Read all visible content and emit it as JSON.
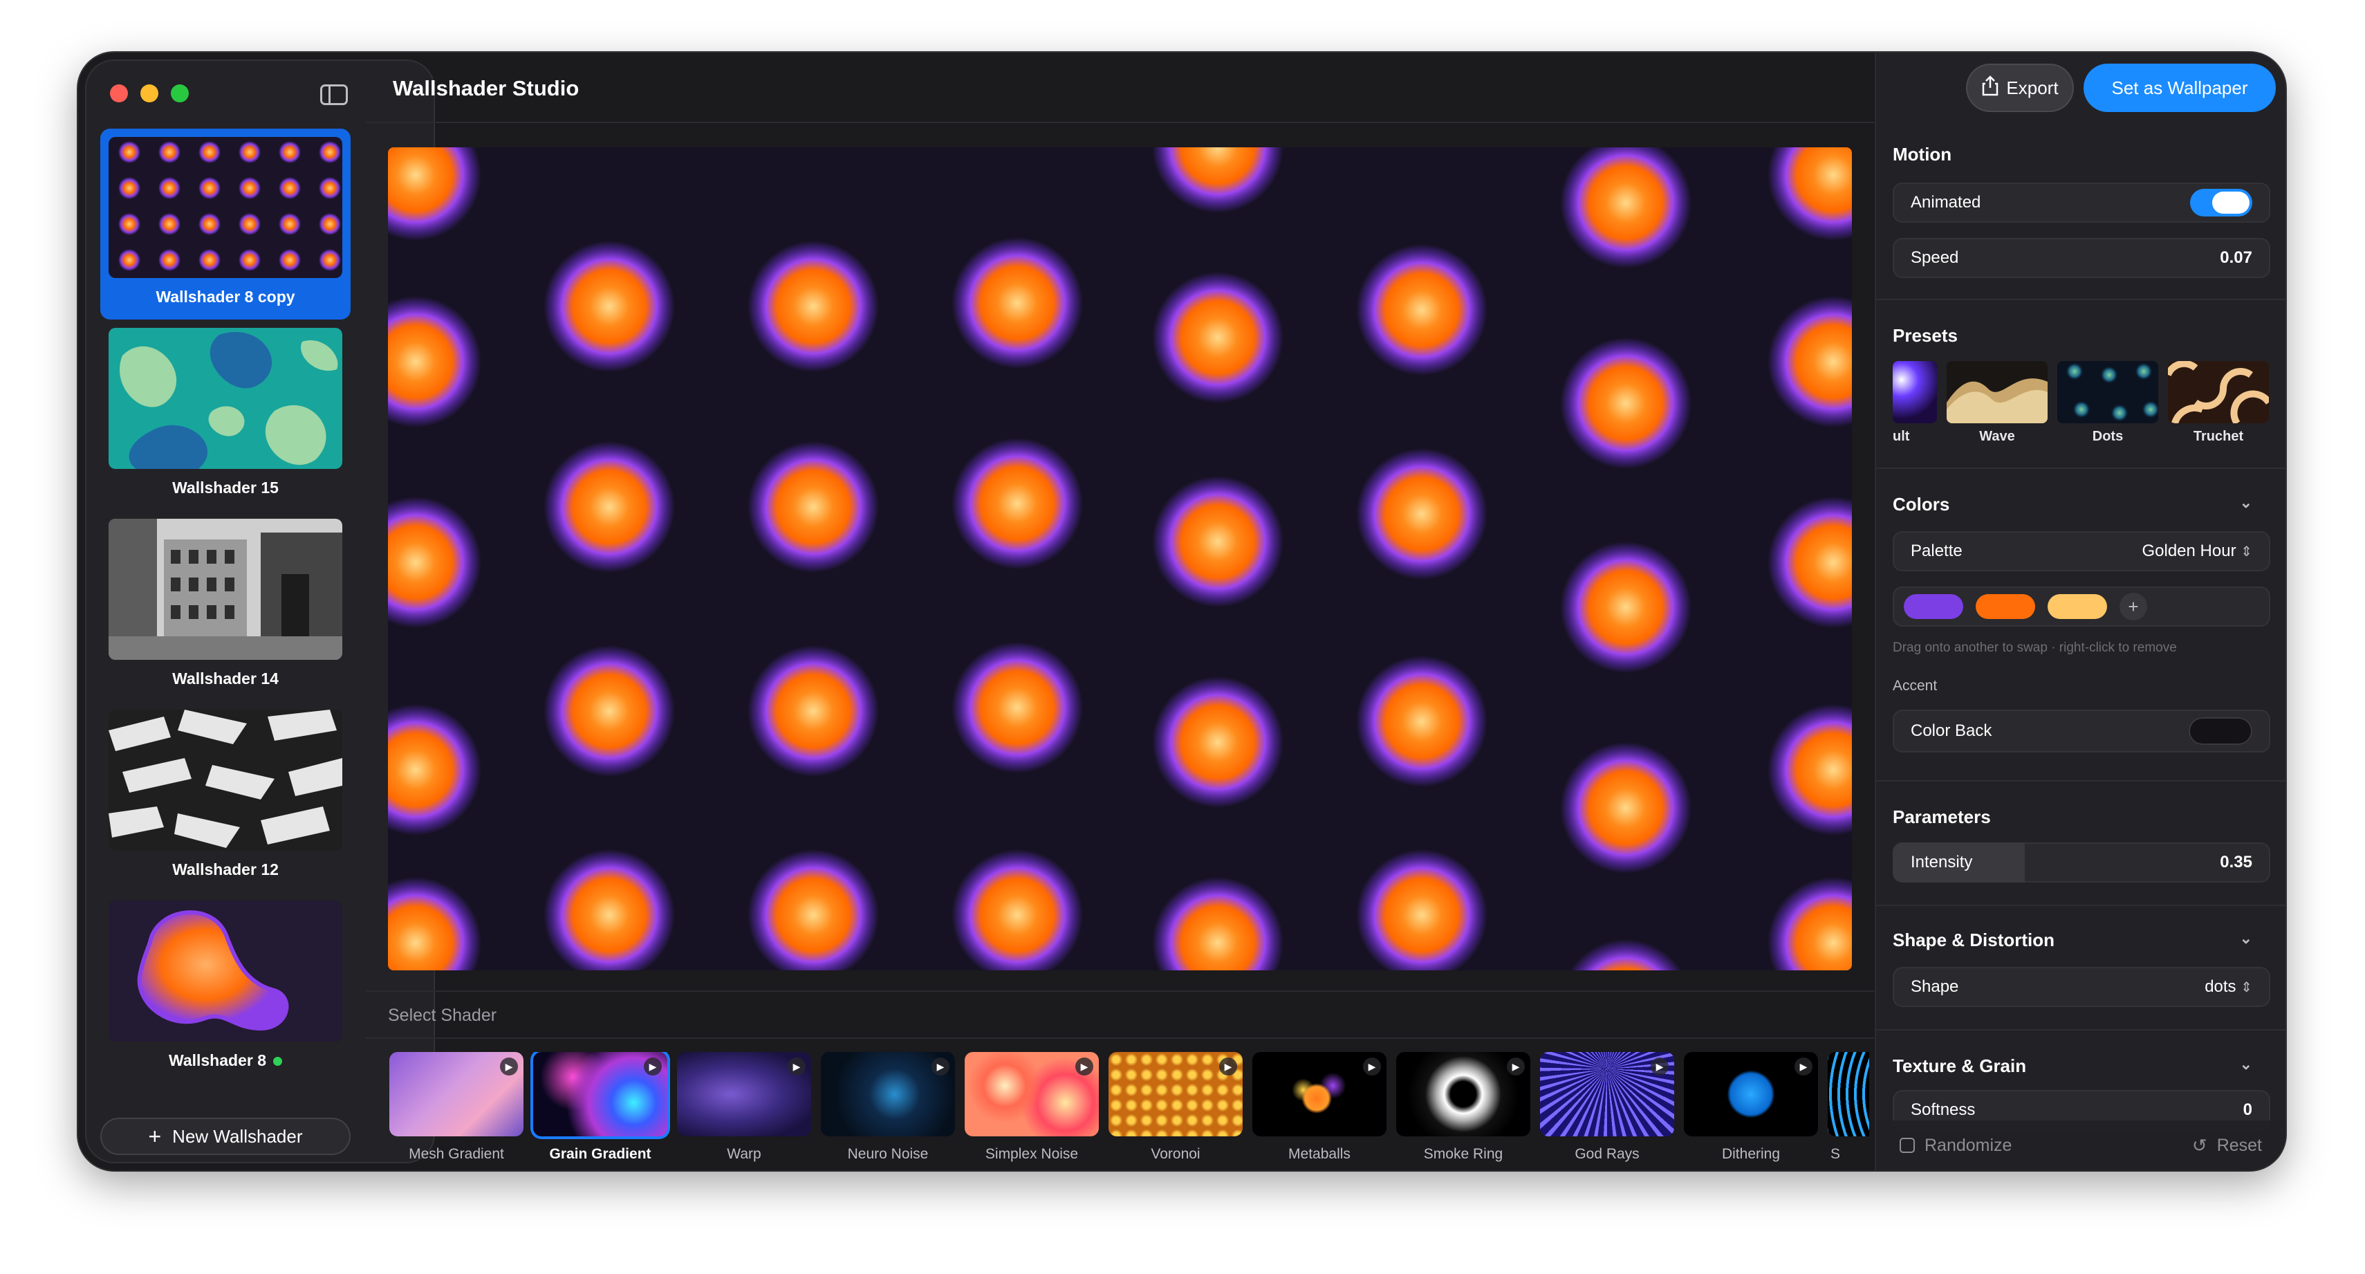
{
  "app": {
    "title": "Wallshader Studio"
  },
  "sidebar": {
    "items": [
      {
        "label": "Wallshader 8 copy",
        "selected": true
      },
      {
        "label": "Wallshader 15"
      },
      {
        "label": "Wallshader 14"
      },
      {
        "label": "Wallshader 12"
      },
      {
        "label": "Wallshader 8",
        "active": true
      }
    ],
    "new_button": "New Wallshader"
  },
  "toolbar": {
    "export_label": "Export",
    "set_wallpaper_label": "Set as Wallpaper"
  },
  "shader_strip": {
    "title": "Select Shader",
    "items": [
      "Mesh Gradient",
      "Grain Gradient",
      "Warp",
      "Neuro Noise",
      "Simplex Noise",
      "Voronoi",
      "Metaballs",
      "Smoke Ring",
      "God Rays",
      "Dithering",
      "S"
    ],
    "selected": "Grain Gradient"
  },
  "inspector": {
    "motion": {
      "title": "Motion",
      "animated_label": "Animated",
      "animated": true,
      "speed_label": "Speed",
      "speed_value": "0.07"
    },
    "presets": {
      "title": "Presets",
      "items": [
        "ult",
        "Wave",
        "Dots",
        "Truchet"
      ]
    },
    "colors": {
      "title": "Colors",
      "palette_label": "Palette",
      "palette_value": "Golden Hour",
      "swatches": [
        "#7b3fe4",
        "#ff6d0a",
        "#ffc766"
      ],
      "hint": "Drag onto another to swap · right-click to remove",
      "accent_label": "Accent",
      "color_back_label": "Color Back",
      "color_back": "#141216"
    },
    "parameters": {
      "title": "Parameters",
      "intensity_label": "Intensity",
      "intensity_value": "0.35"
    },
    "shape": {
      "title": "Shape & Distortion",
      "shape_label": "Shape",
      "shape_value": "dots"
    },
    "texture": {
      "title": "Texture & Grain",
      "softness_label": "Softness",
      "softness_value": "0"
    },
    "footer": {
      "randomize_label": "Randomize",
      "reset_label": "Reset"
    }
  },
  "colors": {
    "accent": "#1a8cff",
    "selection": "#1267e4",
    "window_bg": "#1b1a1d"
  }
}
